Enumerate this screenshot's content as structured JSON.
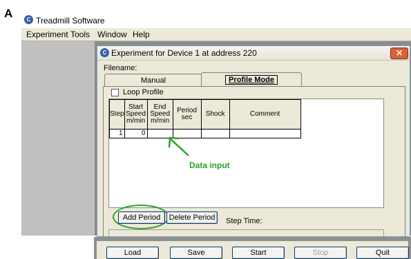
{
  "panel_label": "A",
  "app": {
    "title": "Treadmill Software",
    "menu": [
      "Experiment",
      "Tools",
      "Window",
      "Help"
    ]
  },
  "dialog": {
    "title": "Experiment for Device 1 at address 220",
    "close_label": "✕",
    "filename_label": "Filename:",
    "tabs": [
      "Manual",
      "Profile Mode"
    ],
    "active_tab": "Profile Mode",
    "loop_profile": {
      "label": "Loop Profile",
      "checked": false
    },
    "table": {
      "columns": [
        "Step",
        "Start Speed m/min",
        "End Speed m/min",
        "Period sec",
        "Shock",
        "Comment"
      ],
      "rows": [
        {
          "step": "1",
          "start_speed": "0",
          "end_speed": "",
          "period": "",
          "shock": "",
          "comment": ""
        }
      ]
    },
    "annotation": {
      "text": "Data input",
      "color": "#2aa02a"
    },
    "add_period_label": "Add Period",
    "delete_period_label": "Delete Period",
    "step_time_label": "Step Time:"
  },
  "buttons": {
    "load": "Load",
    "save": "Save",
    "start": "Start",
    "stop": "Stop",
    "quit": "Quit"
  },
  "icons": {
    "app_logo": "c-logo-icon",
    "close": "close-icon",
    "arrow": "arrow-icon"
  }
}
